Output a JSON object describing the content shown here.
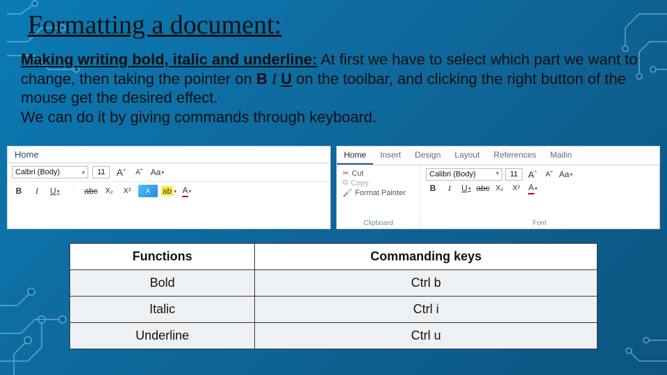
{
  "title": "Formatting a document:",
  "body": {
    "lead": "Making writing bold, italic and underline:",
    "text1": " At first we have to select which part we want to change, then taking the pointer on ",
    "b": "B",
    "i": "I",
    "u": "U",
    "text2": " on the toolbar, and clicking the right button of the mouse get the desired effect.",
    "line2": "We can do it by giving commands through keyboard."
  },
  "ribbonA": {
    "tab": "Home",
    "fontName": "Calbri (Body)",
    "fontSize": "11",
    "icons": {
      "incA": "A",
      "decA": "A",
      "caseAa": "Aa"
    },
    "row2": {
      "b": "B",
      "i": "I",
      "u": "U",
      "strike": "abc",
      "sub": "X₂",
      "sup": "X²",
      "highlight": "ab",
      "colorA": "A"
    }
  },
  "ribbonB": {
    "tabs": [
      "Home",
      "Insert",
      "Design",
      "Layout",
      "References",
      "Mailin"
    ],
    "activeTab": 0,
    "clipboard": {
      "cut": "Cut",
      "copy": "Copy",
      "painter": "Format Painter",
      "groupLabel": "Clipboard"
    },
    "font": {
      "name": "Calibri (Body)",
      "size": "11",
      "incA": "A",
      "decA": "A",
      "caseAa": "Aa",
      "b": "B",
      "i": "I",
      "u": "U",
      "strike": "abc",
      "sub": "X₂",
      "sup": "X²",
      "colorA": "A",
      "groupLabel": "Font"
    }
  },
  "table": {
    "headers": [
      "Functions",
      "Commanding keys"
    ],
    "rows": [
      {
        "fn": "Bold",
        "key": "Ctrl b"
      },
      {
        "fn": "Italic",
        "key": "Ctrl i"
      },
      {
        "fn": "Underline",
        "key": "Ctrl u"
      }
    ]
  }
}
